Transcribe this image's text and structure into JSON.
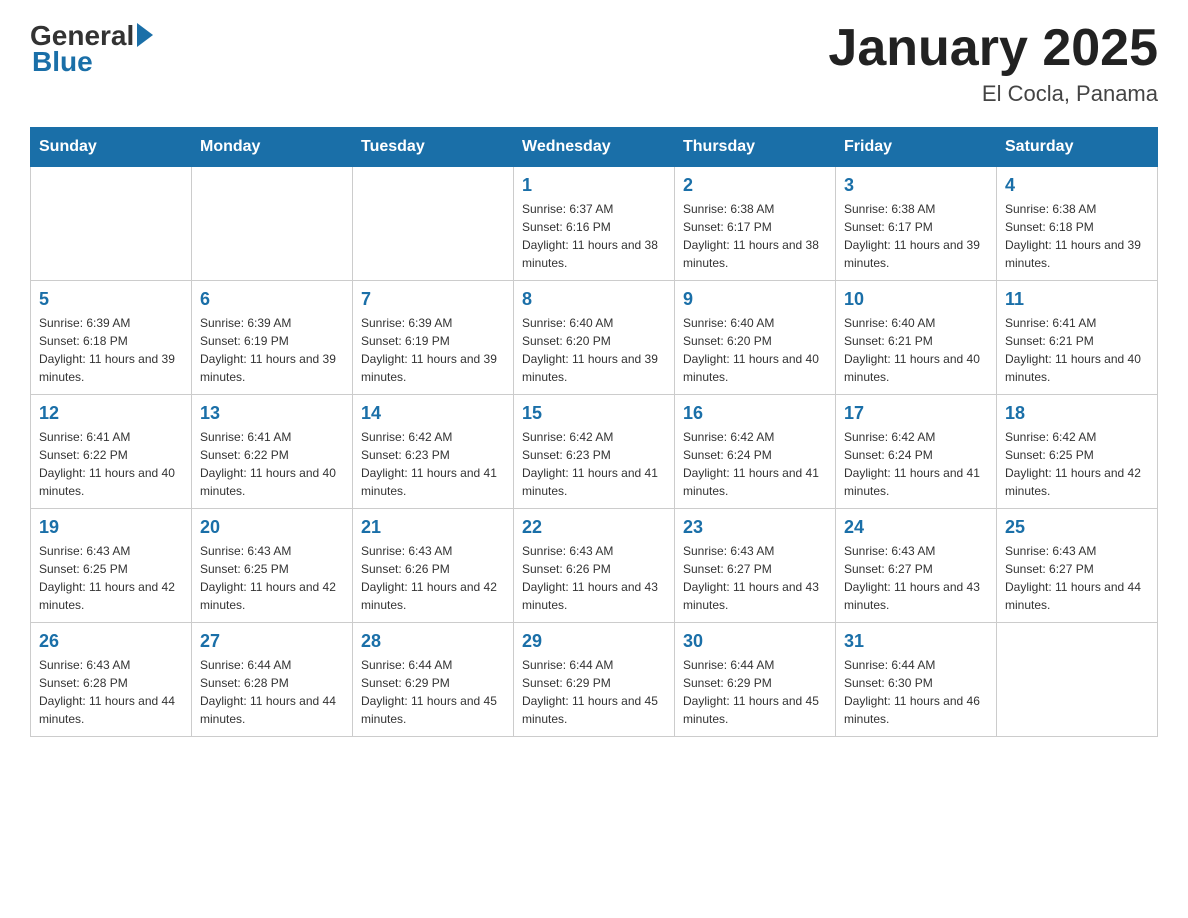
{
  "header": {
    "title": "January 2025",
    "subtitle": "El Cocla, Panama"
  },
  "logo": {
    "general": "General",
    "blue": "Blue"
  },
  "days_of_week": [
    "Sunday",
    "Monday",
    "Tuesday",
    "Wednesday",
    "Thursday",
    "Friday",
    "Saturday"
  ],
  "weeks": [
    [
      {
        "day": "",
        "info": ""
      },
      {
        "day": "",
        "info": ""
      },
      {
        "day": "",
        "info": ""
      },
      {
        "day": "1",
        "info": "Sunrise: 6:37 AM\nSunset: 6:16 PM\nDaylight: 11 hours and 38 minutes."
      },
      {
        "day": "2",
        "info": "Sunrise: 6:38 AM\nSunset: 6:17 PM\nDaylight: 11 hours and 38 minutes."
      },
      {
        "day": "3",
        "info": "Sunrise: 6:38 AM\nSunset: 6:17 PM\nDaylight: 11 hours and 39 minutes."
      },
      {
        "day": "4",
        "info": "Sunrise: 6:38 AM\nSunset: 6:18 PM\nDaylight: 11 hours and 39 minutes."
      }
    ],
    [
      {
        "day": "5",
        "info": "Sunrise: 6:39 AM\nSunset: 6:18 PM\nDaylight: 11 hours and 39 minutes."
      },
      {
        "day": "6",
        "info": "Sunrise: 6:39 AM\nSunset: 6:19 PM\nDaylight: 11 hours and 39 minutes."
      },
      {
        "day": "7",
        "info": "Sunrise: 6:39 AM\nSunset: 6:19 PM\nDaylight: 11 hours and 39 minutes."
      },
      {
        "day": "8",
        "info": "Sunrise: 6:40 AM\nSunset: 6:20 PM\nDaylight: 11 hours and 39 minutes."
      },
      {
        "day": "9",
        "info": "Sunrise: 6:40 AM\nSunset: 6:20 PM\nDaylight: 11 hours and 40 minutes."
      },
      {
        "day": "10",
        "info": "Sunrise: 6:40 AM\nSunset: 6:21 PM\nDaylight: 11 hours and 40 minutes."
      },
      {
        "day": "11",
        "info": "Sunrise: 6:41 AM\nSunset: 6:21 PM\nDaylight: 11 hours and 40 minutes."
      }
    ],
    [
      {
        "day": "12",
        "info": "Sunrise: 6:41 AM\nSunset: 6:22 PM\nDaylight: 11 hours and 40 minutes."
      },
      {
        "day": "13",
        "info": "Sunrise: 6:41 AM\nSunset: 6:22 PM\nDaylight: 11 hours and 40 minutes."
      },
      {
        "day": "14",
        "info": "Sunrise: 6:42 AM\nSunset: 6:23 PM\nDaylight: 11 hours and 41 minutes."
      },
      {
        "day": "15",
        "info": "Sunrise: 6:42 AM\nSunset: 6:23 PM\nDaylight: 11 hours and 41 minutes."
      },
      {
        "day": "16",
        "info": "Sunrise: 6:42 AM\nSunset: 6:24 PM\nDaylight: 11 hours and 41 minutes."
      },
      {
        "day": "17",
        "info": "Sunrise: 6:42 AM\nSunset: 6:24 PM\nDaylight: 11 hours and 41 minutes."
      },
      {
        "day": "18",
        "info": "Sunrise: 6:42 AM\nSunset: 6:25 PM\nDaylight: 11 hours and 42 minutes."
      }
    ],
    [
      {
        "day": "19",
        "info": "Sunrise: 6:43 AM\nSunset: 6:25 PM\nDaylight: 11 hours and 42 minutes."
      },
      {
        "day": "20",
        "info": "Sunrise: 6:43 AM\nSunset: 6:25 PM\nDaylight: 11 hours and 42 minutes."
      },
      {
        "day": "21",
        "info": "Sunrise: 6:43 AM\nSunset: 6:26 PM\nDaylight: 11 hours and 42 minutes."
      },
      {
        "day": "22",
        "info": "Sunrise: 6:43 AM\nSunset: 6:26 PM\nDaylight: 11 hours and 43 minutes."
      },
      {
        "day": "23",
        "info": "Sunrise: 6:43 AM\nSunset: 6:27 PM\nDaylight: 11 hours and 43 minutes."
      },
      {
        "day": "24",
        "info": "Sunrise: 6:43 AM\nSunset: 6:27 PM\nDaylight: 11 hours and 43 minutes."
      },
      {
        "day": "25",
        "info": "Sunrise: 6:43 AM\nSunset: 6:27 PM\nDaylight: 11 hours and 44 minutes."
      }
    ],
    [
      {
        "day": "26",
        "info": "Sunrise: 6:43 AM\nSunset: 6:28 PM\nDaylight: 11 hours and 44 minutes."
      },
      {
        "day": "27",
        "info": "Sunrise: 6:44 AM\nSunset: 6:28 PM\nDaylight: 11 hours and 44 minutes."
      },
      {
        "day": "28",
        "info": "Sunrise: 6:44 AM\nSunset: 6:29 PM\nDaylight: 11 hours and 45 minutes."
      },
      {
        "day": "29",
        "info": "Sunrise: 6:44 AM\nSunset: 6:29 PM\nDaylight: 11 hours and 45 minutes."
      },
      {
        "day": "30",
        "info": "Sunrise: 6:44 AM\nSunset: 6:29 PM\nDaylight: 11 hours and 45 minutes."
      },
      {
        "day": "31",
        "info": "Sunrise: 6:44 AM\nSunset: 6:30 PM\nDaylight: 11 hours and 46 minutes."
      },
      {
        "day": "",
        "info": ""
      }
    ]
  ]
}
